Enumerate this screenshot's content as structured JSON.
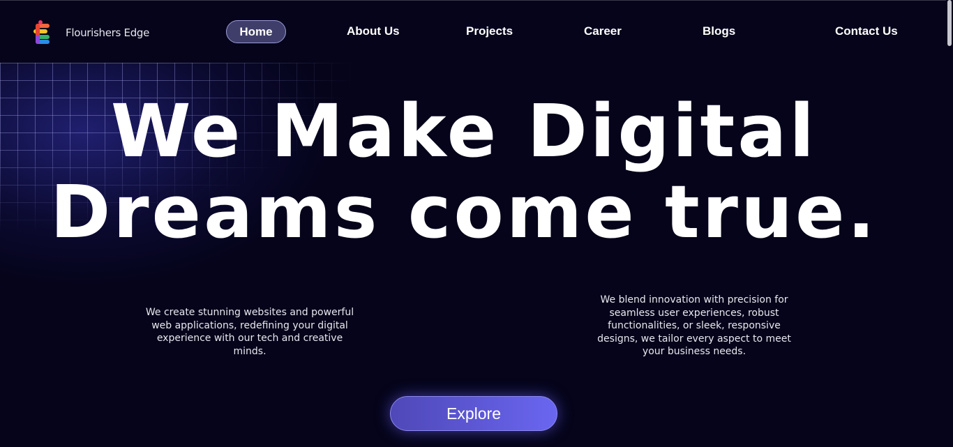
{
  "header": {
    "brand_name": "Flourishers Edge",
    "logo_icon": "flourishers-edge-logo",
    "nav": {
      "home": "Home",
      "about": "About Us",
      "projects": "Projects",
      "career": "Career",
      "blogs": "Blogs",
      "contact": "Contact Us"
    },
    "active_nav": "Home"
  },
  "hero": {
    "headline_line1": "We Make Digital",
    "headline_line2": "Dreams come true.",
    "description_left": "We create stunning websites and powerful web applications, redefining your digital experience  with our tech and creative minds.",
    "description_right": "We blend innovation with precision for seamless user experiences, robust functionalities, or sleek, responsive designs, we tailor every aspect to meet your business needs.",
    "cta_label": "Explore"
  },
  "colors": {
    "background": "#05041a",
    "nav_active_bg": "#3f3e6a",
    "accent_start": "#4f48b8",
    "accent_end": "#6a66f0"
  }
}
